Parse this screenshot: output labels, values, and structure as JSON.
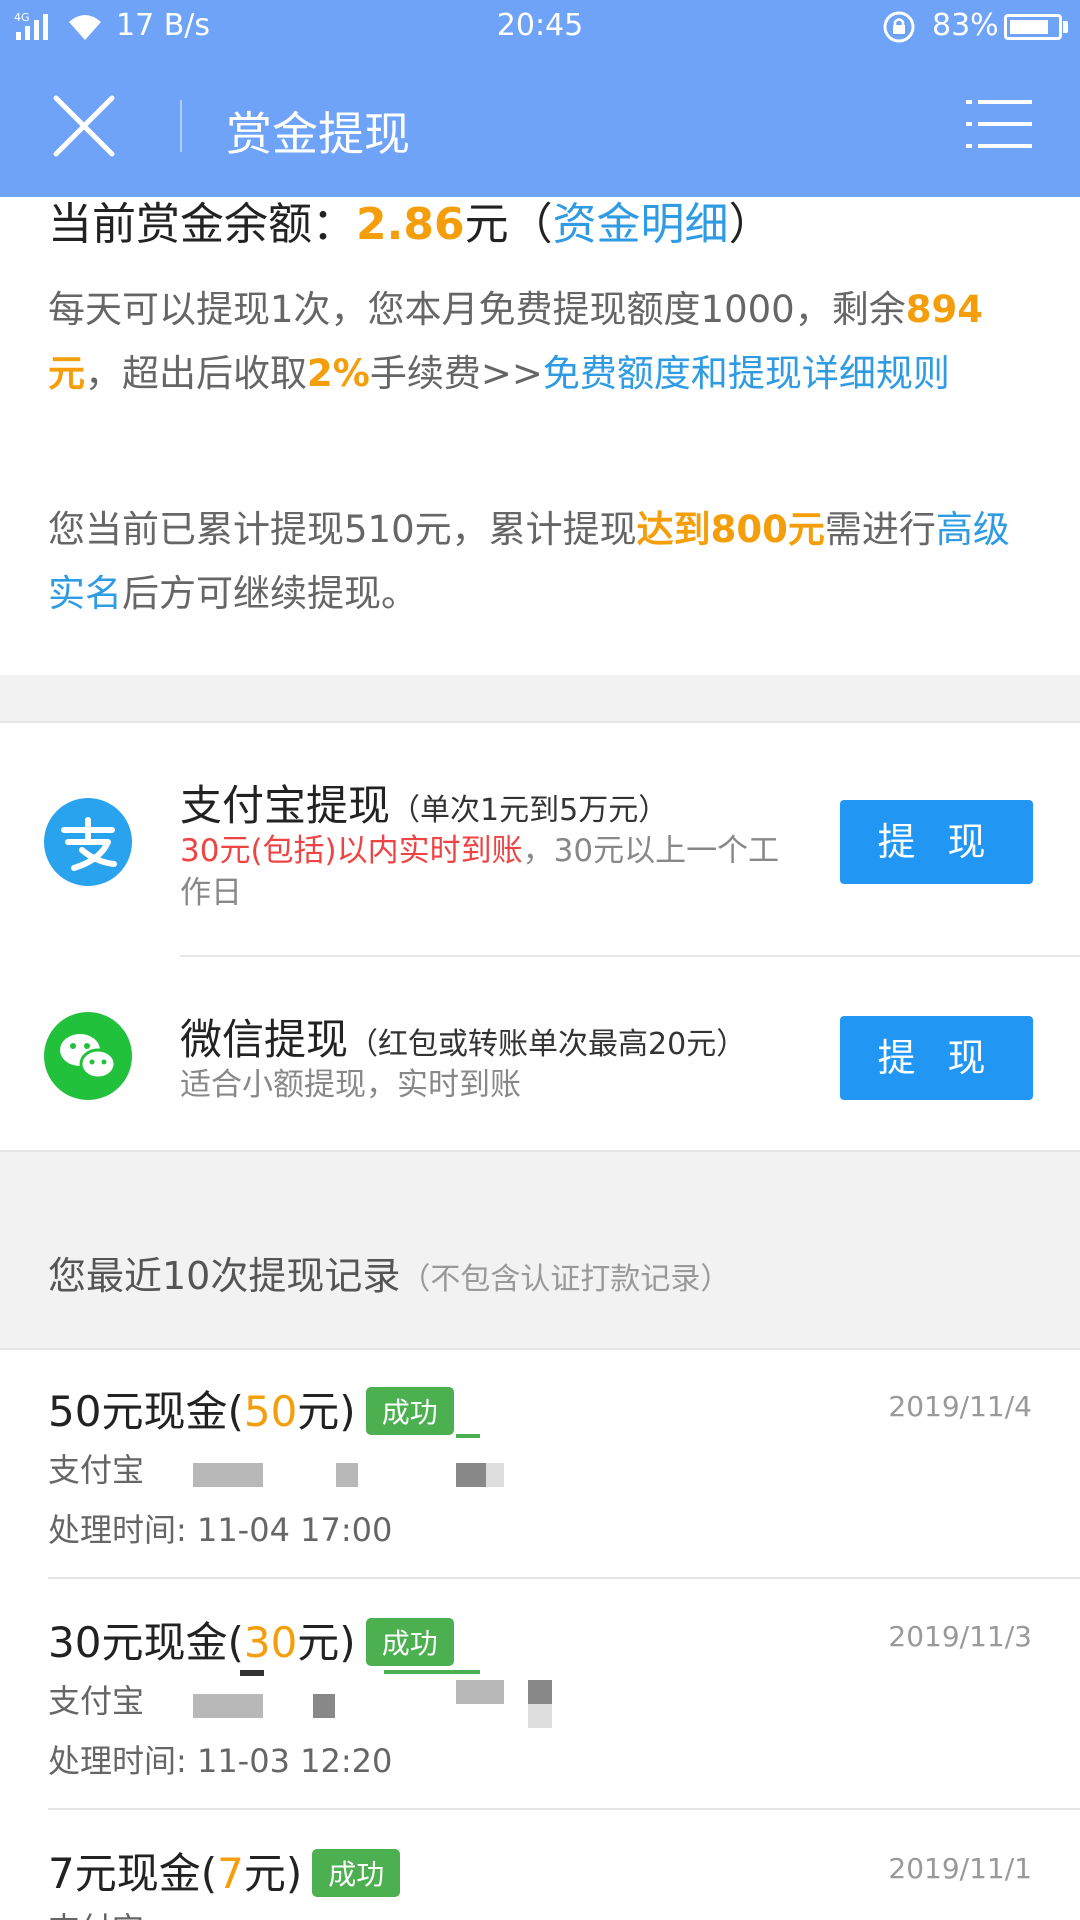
{
  "status_bar": {
    "network": "4G",
    "speed": "17 B/s",
    "time": "20:45",
    "battery_percent": "83%",
    "battery_level": 0.83
  },
  "nav": {
    "title": "赏金提现"
  },
  "balance": {
    "label": "当前赏金余额：",
    "amount": "2.86",
    "unit": "元",
    "paren_open": "（",
    "detail_link": "资金明细",
    "paren_close": "）"
  },
  "rules": {
    "line1_a": "每天可以提现1次，您本月免费提现额度1000，剩余",
    "remaining": "894元",
    "line1_b": "，超出后收取",
    "fee": "2%",
    "line1_c": "手续费>>",
    "rules_link": "免费额度和提现详细规则",
    "line2_a": "您当前已累计提现510元，累计提现",
    "threshold": "达到800元",
    "line2_b": "需进行",
    "realname_link": "高级实名",
    "line2_c": "后方可继续提现。"
  },
  "options": [
    {
      "name": "支付宝提现",
      "limit": "（单次1元到5万元）",
      "desc_red": "30元(包括)以内实时到账",
      "desc_rest": "，30元以上一个工作日",
      "button": "提 现"
    },
    {
      "name": "微信提现",
      "limit_a": "（红包或转账单次最高",
      "limit_red": "20元",
      "limit_b": "）",
      "desc": "适合小额提现，实时到账",
      "button": "提 现"
    }
  ],
  "records_header": {
    "title": "您最近10次提现记录",
    "note": "（不包含认证打款记录）"
  },
  "records": [
    {
      "label": "50元现金(",
      "amount": "50",
      "label_end": "元)",
      "status": "成功",
      "date": "2019/11/4",
      "method": "支付宝",
      "time": "处理时间: 11-04 17:00"
    },
    {
      "label": "30元现金(",
      "amount": "30",
      "label_end": "元)",
      "status": "成功",
      "date": "2019/11/3",
      "method": "支付宝",
      "time": "处理时间: 11-03 12:20"
    },
    {
      "label": "7元现金(",
      "amount": "7",
      "label_end": "元)",
      "status": "成功",
      "date": "2019/11/1",
      "method": "支付宝"
    }
  ],
  "colors": {
    "header_bg": "#6ea3f8",
    "accent_orange": "#f59e0b",
    "link_blue": "#2f9be3",
    "button_blue": "#2196f3",
    "success_green": "#4caf50",
    "warning_red": "#ef4444"
  },
  "icons": [
    "signal-icon",
    "wifi-icon",
    "lock-rotation-icon",
    "battery-icon",
    "close-icon",
    "menu-icon",
    "alipay-icon",
    "wechat-icon"
  ]
}
